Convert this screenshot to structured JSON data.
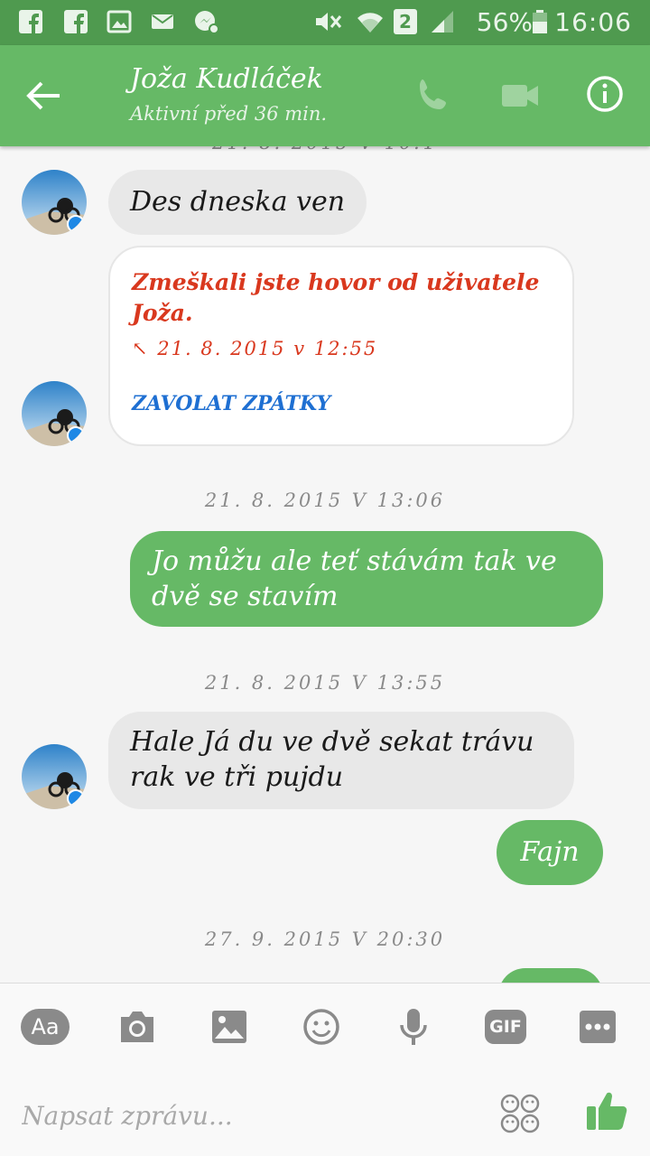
{
  "status_bar": {
    "battery_percent": "56%",
    "time": "16:06",
    "sim_slot": "2",
    "icons": [
      "facebook-icon",
      "facebook-icon",
      "gallery-icon",
      "mail-icon",
      "messenger-icon",
      "mute-icon",
      "wifi-icon",
      "signal-icon",
      "battery-icon"
    ]
  },
  "header": {
    "name": "Joža Kudláček",
    "status": "Aktivní před 36 min.",
    "icons": [
      "back-arrow-icon",
      "phone-icon",
      "video-icon",
      "info-icon"
    ]
  },
  "conversation": {
    "top_cut_timestamp": "21. 8. 2015 V 10:1",
    "messages": [
      {
        "type": "incoming",
        "text": "Des dneska ven"
      },
      {
        "type": "missed_call",
        "text": "Zmeškali jste hovor od uživatele Joža.",
        "date": "21. 8. 2015 v 12:55",
        "action": "ZAVOLAT ZPÁTKY"
      },
      {
        "type": "timestamp",
        "text": "21. 8. 2015 V 13:06"
      },
      {
        "type": "outgoing",
        "text": "Jo můžu ale teť stávám tak ve dvě se stavím"
      },
      {
        "type": "timestamp",
        "text": "21. 8. 2015 V 13:55"
      },
      {
        "type": "incoming",
        "text": "Hale Já du ve dvě sekat trávu rak ve tři pujdu"
      },
      {
        "type": "outgoing",
        "text": "Fajn"
      },
      {
        "type": "timestamp",
        "text": "27. 9. 2015 V 20:30"
      }
    ]
  },
  "composer": {
    "aa_label": "Aa",
    "gif_label": "GIF",
    "placeholder": "Napsat zprávu...",
    "icons": [
      "camera-icon",
      "image-icon",
      "emoji-icon",
      "microphone-icon",
      "more-icon",
      "sticker-icon",
      "like-icon"
    ]
  },
  "colors": {
    "primary": "#66b966",
    "status_bar": "#4f9a4f",
    "missed_call": "#d9381e",
    "link": "#1e6fd2",
    "incoming_bubble": "#e8e8e8"
  }
}
